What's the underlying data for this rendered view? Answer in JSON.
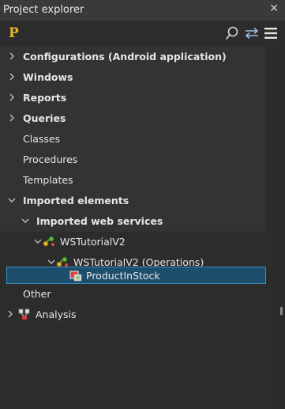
{
  "window": {
    "title": "Project explorer"
  },
  "tree": {
    "configurations": "Configurations (Android application)",
    "windows": "Windows",
    "reports": "Reports",
    "queries": "Queries",
    "classes": "Classes",
    "procedures": "Procedures",
    "templates": "Templates",
    "imported_elements": "Imported elements",
    "imported_web_services": "Imported web services",
    "ws_tutorial": "WSTutorialV2",
    "ws_operations": "WSTutorialV2 (Operations)",
    "product_in_stock": "ProductInStock",
    "other": "Other",
    "analysis": "Analysis"
  },
  "icons": {
    "close": "close-icon",
    "search": "search-icon",
    "sync": "sync-arrows-icon",
    "menu": "hamburger-menu-icon",
    "webservice": "webservice-icon",
    "operation": "operation-icon",
    "analysis": "analysis-icon"
  },
  "colors": {
    "selection_bg": "#1d4f6c",
    "selection_border": "#3a8fc4",
    "logo": "#f0b429"
  }
}
